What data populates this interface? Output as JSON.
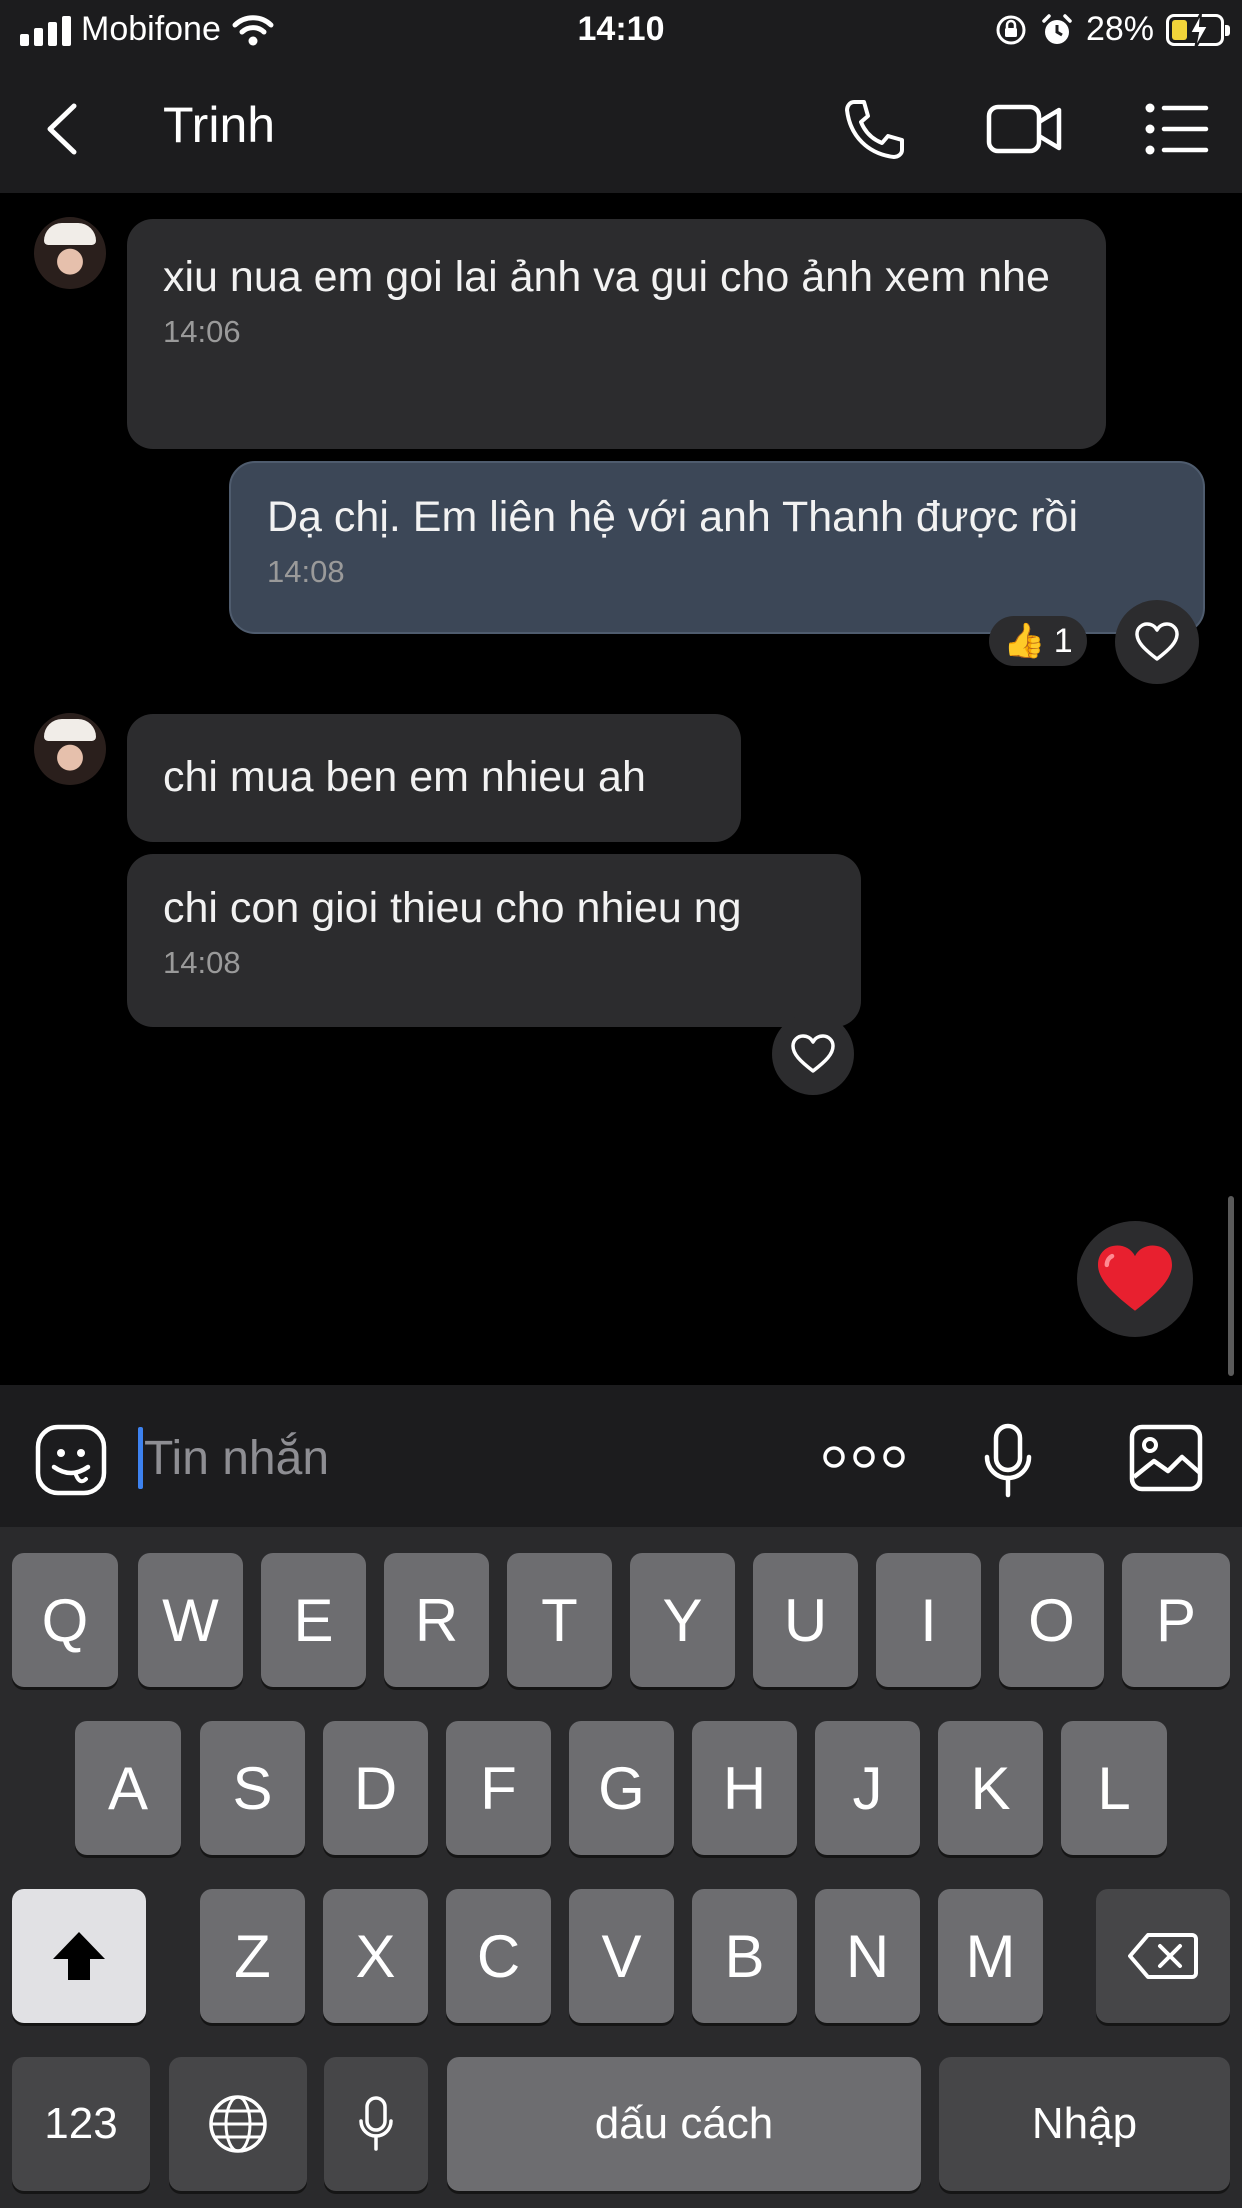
{
  "status_bar": {
    "carrier": "Mobifone",
    "time": "14:10",
    "battery": "28%"
  },
  "header": {
    "contact_name": "Trinh"
  },
  "messages": [
    {
      "text": "xiu nua em goi lai ảnh va gui cho ảnh xem nhe",
      "time": "14:06"
    },
    {
      "text": "Dạ chị. Em liên hệ với anh Thanh được rồi",
      "time": "14:08",
      "reaction_count": "1"
    },
    {
      "text": "chi mua ben em nhieu ah"
    },
    {
      "text": "chi con gioi thieu cho nhieu ng",
      "time": "14:08"
    }
  ],
  "input": {
    "placeholder": "Tin nhắn"
  },
  "keyboard": {
    "row1": [
      "Q",
      "W",
      "E",
      "R",
      "T",
      "Y",
      "U",
      "I",
      "O",
      "P"
    ],
    "row2": [
      "A",
      "S",
      "D",
      "F",
      "G",
      "H",
      "J",
      "K",
      "L"
    ],
    "row3": [
      "Z",
      "X",
      "C",
      "V",
      "B",
      "N",
      "M"
    ],
    "numbers_key": "123",
    "space_key": "dấu cách",
    "return_key": "Nhập"
  },
  "colors": {
    "accent_caret": "#3d82f0",
    "my_bubble": "#3c4757",
    "their_bubble": "#2c2c2e",
    "heart": "#e8202f"
  },
  "icons": [
    "back-chevron-icon",
    "phone-icon",
    "video-camera-icon",
    "list-menu-icon",
    "sticker-icon",
    "more-dots-icon",
    "microphone-icon",
    "image-icon",
    "heart-icon",
    "thumbs-up-icon",
    "globe-icon",
    "shift-icon",
    "backspace-icon"
  ]
}
